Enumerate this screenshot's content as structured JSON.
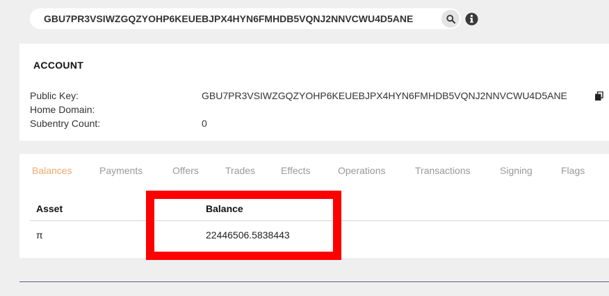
{
  "search": {
    "value": "GBU7PR3VSIWZGQZYOHP6KEUEBJPX4HYN6FMHDB5VQNJ2NNVCWU4D5ANE"
  },
  "account": {
    "title": "ACCOUNT",
    "fields": [
      {
        "label": "Public Key:",
        "value": "GBU7PR3VSIWZGQZYOHP6KEUEBJPX4HYN6FMHDB5VQNJ2NNVCWU4D5ANE"
      },
      {
        "label": "Home Domain:",
        "value": ""
      },
      {
        "label": "Subentry Count:",
        "value": "0"
      }
    ]
  },
  "tabs": [
    {
      "label": "Balances",
      "active": true
    },
    {
      "label": "Payments",
      "active": false
    },
    {
      "label": "Offers",
      "active": false
    },
    {
      "label": "Trades",
      "active": false
    },
    {
      "label": "Effects",
      "active": false
    },
    {
      "label": "Operations",
      "active": false
    },
    {
      "label": "Transactions",
      "active": false
    },
    {
      "label": "Signing",
      "active": false
    },
    {
      "label": "Flags",
      "active": false
    }
  ],
  "balances": {
    "headers": {
      "asset": "Asset",
      "balance": "Balance"
    },
    "rows": [
      {
        "asset": "π",
        "balance": "22446506.5838443"
      }
    ]
  },
  "icons": {
    "search": "search-icon",
    "info": "info-circle-icon",
    "copy": "copy-icon"
  },
  "colors": {
    "active_tab": "#f0a86b",
    "inactive_tab": "#999999",
    "highlight": "#ff0000",
    "background": "#efefef"
  }
}
